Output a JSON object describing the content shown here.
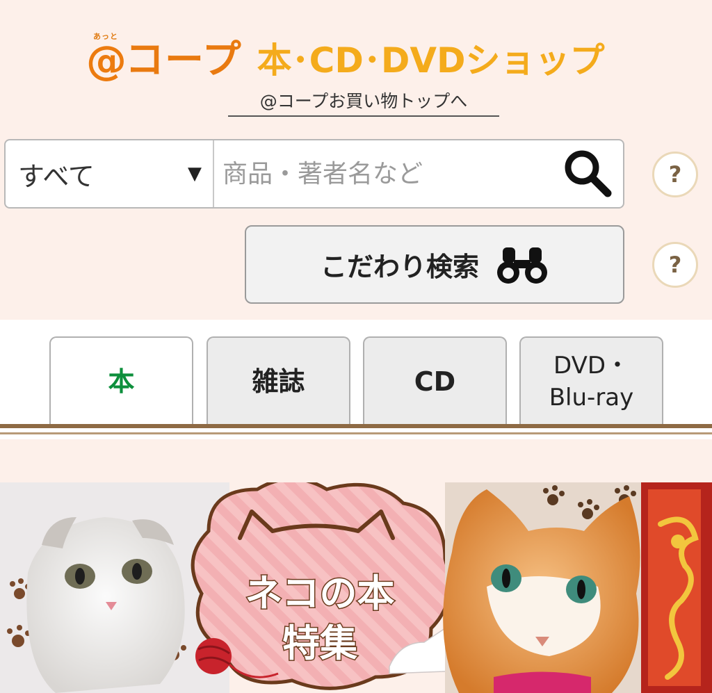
{
  "logo": {
    "ruby": "あっと",
    "at": "@",
    "coop": "コープ",
    "shop": "本･CD･DVDショップ"
  },
  "top_link": "@コープお買い物トップへ",
  "search": {
    "category_value": "すべて",
    "placeholder": "商品・著者名など",
    "help": "?"
  },
  "advanced_search": {
    "label": "こだわり検索",
    "help": "?"
  },
  "tabs": [
    {
      "label": "本",
      "active": true
    },
    {
      "label": "雑誌",
      "active": false
    },
    {
      "label": "CD",
      "active": false
    },
    {
      "label": "DVD・",
      "label2": "Blu-ray",
      "active": false
    }
  ],
  "banner": {
    "line1": "ネコの本",
    "line2": "特集"
  },
  "colors": {
    "background": "#fdf0ea",
    "brand_orange": "#ec7b0f",
    "brand_yellow": "#f4ab1c",
    "active_tab_green": "#0d8f3c",
    "tab_rule": "#8e6a44"
  }
}
